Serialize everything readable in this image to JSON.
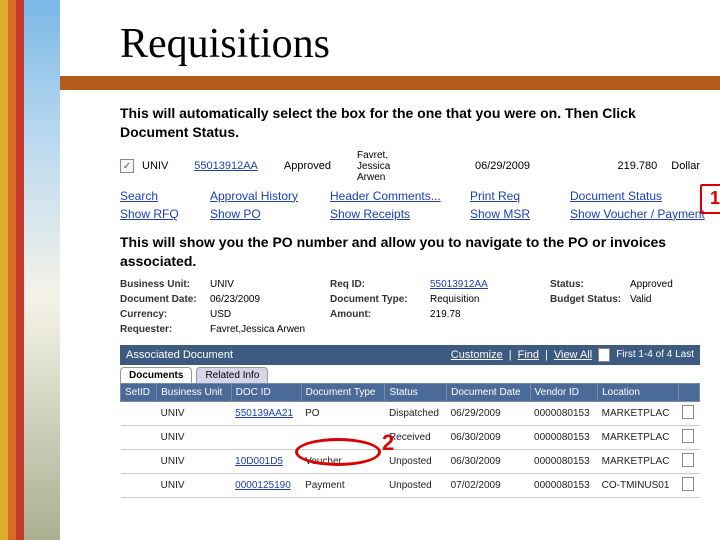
{
  "title": "Requisitions",
  "instruction1": "This will automatically select the box for the one that you were on. Then Click Document Status.",
  "instruction2": "This will show you the PO number and allow you to navigate to the PO or invoices associated.",
  "selectedRow": {
    "bu": "UNIV",
    "reqId": "55013912AA",
    "status": "Approved",
    "name": "Favret, Jessica Arwen",
    "date": "06/29/2009",
    "amount": "219.780",
    "currency": "Dollar"
  },
  "links": {
    "search": "Search",
    "showRFQ": "Show RFQ",
    "approvalHistory": "Approval History",
    "showPO": "Show PO",
    "headerComments": "Header Comments...",
    "showReceipts": "Show Receipts",
    "printReq": "Print Req",
    "showMSR": "Show MSR",
    "documentStatus": "Document Status",
    "showVoucher": "Show Voucher / Payment"
  },
  "callouts": {
    "one": "1",
    "two": "2"
  },
  "detail": {
    "labels": {
      "bu": "Business Unit:",
      "reqId": "Req ID:",
      "status": "Status:",
      "docDate": "Document Date:",
      "docType": "Document Type:",
      "budget": "Budget Status:",
      "currency": "Currency:",
      "amount": "Amount:",
      "requester": "Requester:"
    },
    "values": {
      "bu": "UNIV",
      "reqId": "55013912AA",
      "status": "Approved",
      "docDate": "06/23/2009",
      "docType": "Requisition",
      "budget": "Valid",
      "currency": "USD",
      "amount": "219.78",
      "requester": "Favret,Jessica Arwen"
    }
  },
  "assoc": {
    "header": "Associated Document",
    "customize": "Customize",
    "find": "Find",
    "viewAll": "View All",
    "nav": "First   1-4 of 4   Last",
    "tabs": {
      "documents": "Documents",
      "related": "Related Info"
    },
    "cols": {
      "setid": "SetID",
      "bu": "Business Unit",
      "docid": "DOC ID",
      "doctype": "Document Type",
      "status": "Status",
      "docdate": "Document Date",
      "vendor": "Vendor ID",
      "location": "Location"
    },
    "rows": [
      {
        "setid": "",
        "bu": "UNIV",
        "docid": "550139AA21",
        "doctype": "PO",
        "status": "Dispatched",
        "docdate": "06/29/2009",
        "vendor": "0000080153",
        "location": "MARKETPLAC"
      },
      {
        "setid": "",
        "bu": "UNIV",
        "docid": "",
        "doctype": "",
        "status": "Received",
        "docdate": "06/30/2009",
        "vendor": "0000080153",
        "location": "MARKETPLAC"
      },
      {
        "setid": "",
        "bu": "UNIV",
        "docid": "10D001D5",
        "doctype": "Voucher",
        "status": "Unposted",
        "docdate": "06/30/2009",
        "vendor": "0000080153",
        "location": "MARKETPLAC"
      },
      {
        "setid": "",
        "bu": "UNIV",
        "docid": "0000125190",
        "doctype": "Payment",
        "status": "Unposted",
        "docdate": "07/02/2009",
        "vendor": "0000080153",
        "location": "CO-TMINUS01"
      }
    ]
  }
}
